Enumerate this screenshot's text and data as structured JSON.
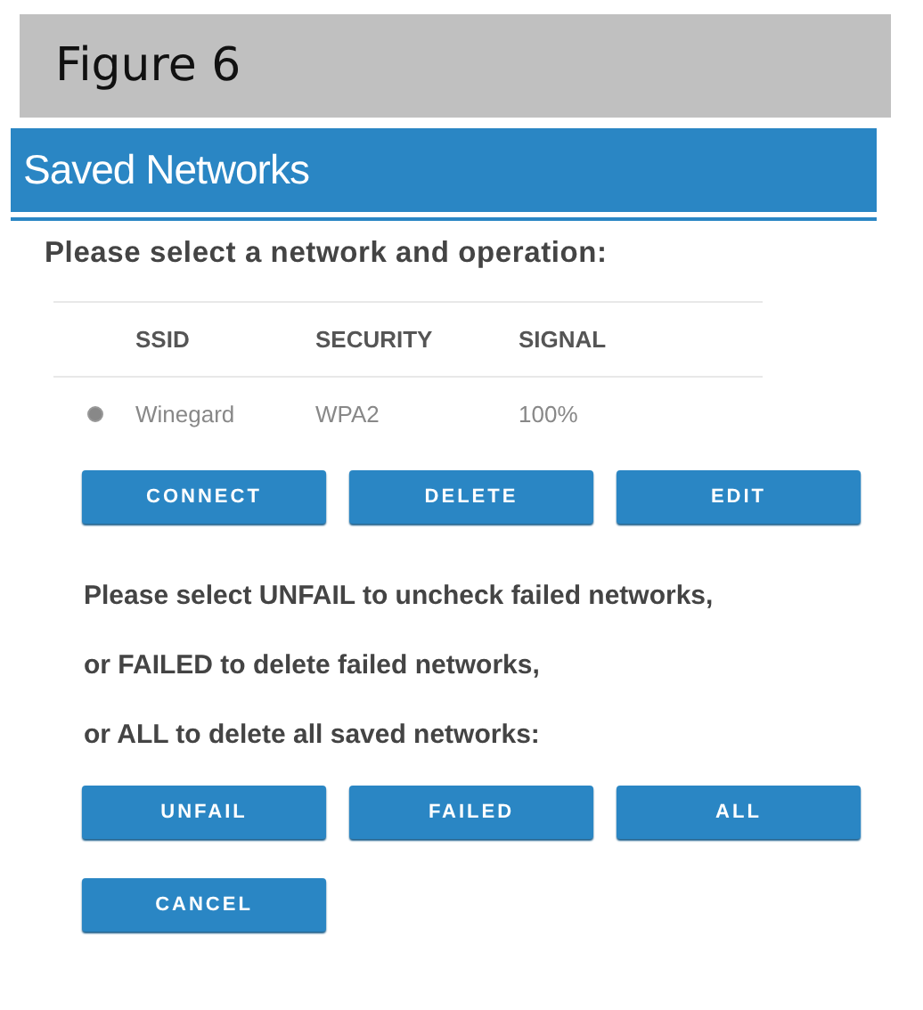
{
  "caption": "Figure 6",
  "header": {
    "title": "Saved Networks"
  },
  "prompt": "Please select a network and operation:",
  "table": {
    "columns": [
      "SSID",
      "SECURITY",
      "SIGNAL"
    ],
    "rows": [
      {
        "selected": true,
        "cells": [
          "Winegard",
          "WPA2",
          "100%"
        ]
      }
    ]
  },
  "operation_buttons": [
    "CONNECT",
    "DELETE",
    "EDIT"
  ],
  "instructions": [
    "Please select UNFAIL to uncheck failed networks,",
    "or FAILED to delete failed networks,",
    "or ALL to delete all saved networks:"
  ],
  "cleanup_buttons": [
    "UNFAIL",
    "FAILED",
    "ALL"
  ],
  "cancel_button": "CANCEL"
}
